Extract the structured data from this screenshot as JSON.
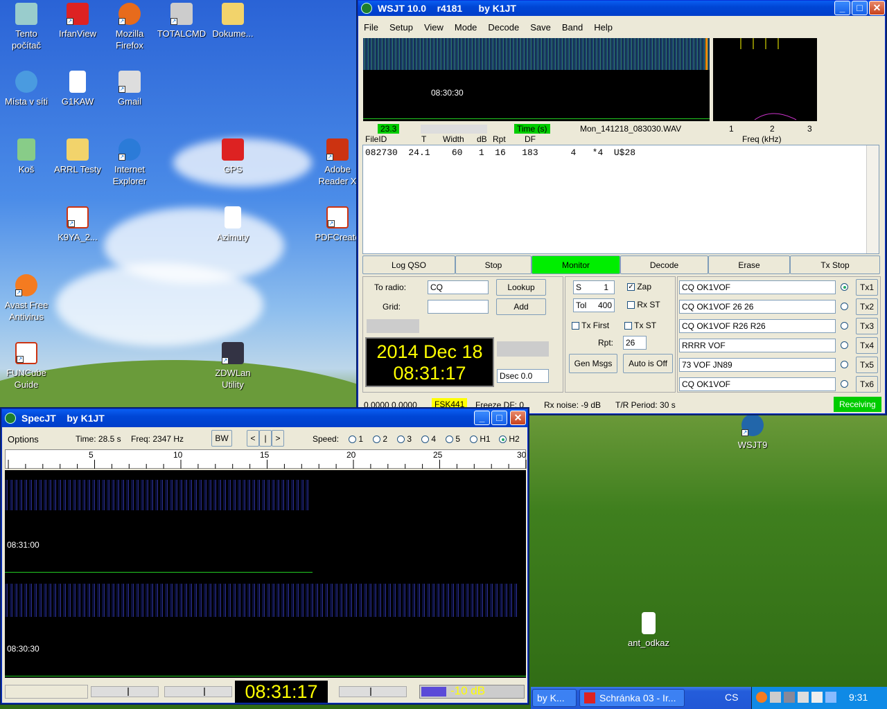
{
  "desktop": {
    "icons": [
      {
        "label": "Tento počítač"
      },
      {
        "label": "IrfanView"
      },
      {
        "label": "Mozilla Firefox"
      },
      {
        "label": "TOTALCMD"
      },
      {
        "label": "Dokume..."
      },
      {
        "label": "Místa v síti"
      },
      {
        "label": "G1KAW"
      },
      {
        "label": "Gmail"
      },
      {
        "label": "Koš"
      },
      {
        "label": "ARRL Testy"
      },
      {
        "label": "Internet Explorer"
      },
      {
        "label": "GPS"
      },
      {
        "label": "Adobe Reader X"
      },
      {
        "label": "K9YA_2..."
      },
      {
        "label": "Azimuty"
      },
      {
        "label": "PDFCreato"
      },
      {
        "label": "Avast Free Antivirus"
      },
      {
        "label": "FUNCube Guide"
      },
      {
        "label": "ZDWLan Utility"
      },
      {
        "label": "WSJT9"
      },
      {
        "label": "ant_odkaz"
      }
    ]
  },
  "wsjt": {
    "title": "WSJT 10.0    r4181      by K1JT",
    "menu": [
      "File",
      "Setup",
      "View",
      "Mode",
      "Decode",
      "Save",
      "Band",
      "Help"
    ],
    "waterfall_time": "08:30:30",
    "status_val": "23.3",
    "time_label": "Time (s)",
    "wav_file": "Mon_141218_083030.WAV",
    "freq_ticks": [
      "1",
      "2",
      "3"
    ],
    "freq_label": "Freq (kHz)",
    "cols": {
      "fileid": "FileID",
      "t": "T",
      "width": "Width",
      "db": "dB",
      "rpt": "Rpt",
      "df": "DF"
    },
    "decode_line": "082730  24.1    60   1  16   183      4   *4  U$28",
    "buttons": {
      "log_qso": "Log QSO",
      "stop": "Stop",
      "monitor": "Monitor",
      "decode": "Decode",
      "erase": "Erase",
      "tx_stop": "Tx Stop"
    },
    "to_radio_label": "To radio:",
    "to_radio_value": "CQ",
    "grid_label": "Grid:",
    "grid_value": "",
    "lookup": "Lookup",
    "add": "Add",
    "date": "2014 Dec 18",
    "clock": "08:31:17",
    "dsec": "Dsec  0.0",
    "s_label": "S",
    "s_value": "1",
    "tol_label": "Tol",
    "tol_value": "400",
    "zap": "Zap",
    "rx_st": "Rx ST",
    "tx_first": "Tx First",
    "tx_st": "Tx ST",
    "rpt_label": "Rpt:",
    "rpt_value": "26",
    "gen_msgs": "Gen Msgs",
    "auto_off": "Auto is Off",
    "tx_msgs": [
      {
        "text": "CQ OK1VOF",
        "btn": "Tx1"
      },
      {
        "text": "CQ OK1VOF 26 26",
        "btn": "Tx2"
      },
      {
        "text": "CQ OK1VOF R26 R26",
        "btn": "Tx3"
      },
      {
        "text": "RRRR VOF",
        "btn": "Tx4"
      },
      {
        "text": "73 VOF JN89",
        "btn": "Tx5"
      },
      {
        "text": "CQ OK1VOF",
        "btn": "Tx6"
      }
    ],
    "sb": {
      "coords": "0.0000 0.0000",
      "mode": "FSK441",
      "freeze": "Freeze DF:  0",
      "rx_noise": "Rx noise: -9 dB",
      "tr_period": "T/R Period: 30 s",
      "state": "Receiving"
    }
  },
  "specjt": {
    "title": "SpecJT    by K1JT",
    "options": "Options",
    "time": "Time: 28.5 s",
    "freq": "Freq: 2347 Hz",
    "bw": "BW",
    "nav": [
      "<",
      "|",
      ">"
    ],
    "speed_label": "Speed:",
    "speeds": [
      "1",
      "2",
      "3",
      "4",
      "5",
      "H1",
      "H2"
    ],
    "ruler": [
      "5",
      "10",
      "15",
      "20",
      "25",
      "30"
    ],
    "t1": "08:31:00",
    "t2": "08:30:30",
    "clock": "08:31:17",
    "level": "-10 dB"
  },
  "taskbar": {
    "btn1": "by K...",
    "btn2": "Schránka 03 - Ir...",
    "lang": "CS",
    "time": "9:31"
  }
}
